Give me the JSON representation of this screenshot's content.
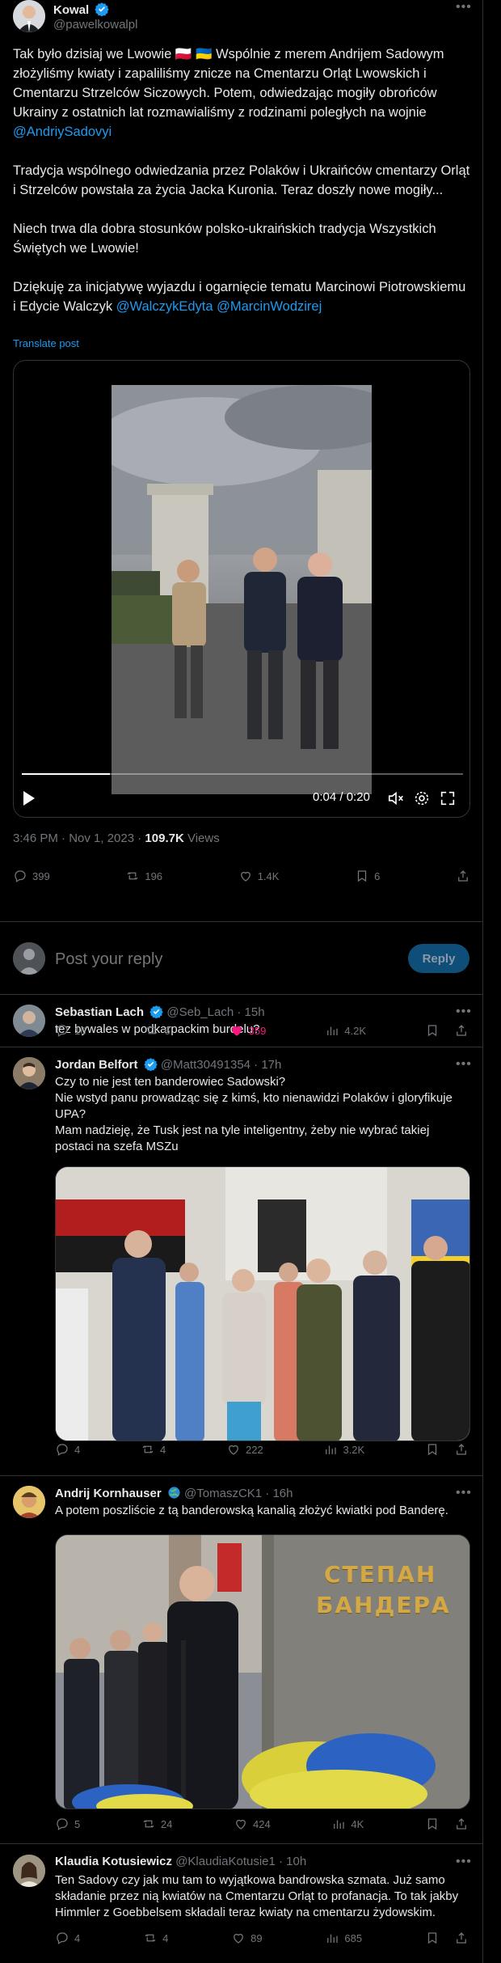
{
  "main_post": {
    "display_name": "Kowal",
    "handle": "@pawelkowalpl",
    "paragraphs": [
      "Tak było dzisiaj we Lwowie 🇵🇱 🇺🇦 Wspólnie z merem Andrijem Sadowym złożyliśmy kwiaty i zapaliliśmy znicze na Cmentarzu Orląt Lwowskich i Cmentarzu Strzelców Siczowych. Potem, odwiedzając mogiły obrońców Ukrainy z ostatnich lat rozmawialiśmy z rodzinami poległych na wojnie",
      "Tradycja wspólnego odwiedzania przez Polaków i Ukraińców cmentarzy Orląt i Strzelców powstała za życia Jacka Kuronia. Teraz doszły nowe mogiły...",
      "Niech trwa dla dobra stosunków polsko-ukraińskich tradycja Wszystkich Świętych we Lwowie!",
      "Dziękuję za inicjatywę wyjazdu i ogarnięcie tematu Marcinowi Piotrowskiemu i Edycie Walczyk"
    ],
    "mention_1": "@AndriySadovyi",
    "mention_2": "@WalczykEdyta",
    "mention_3": "@MarcinWodzirej",
    "translate": "Translate post",
    "video_time": "0:04 / 0:20",
    "video_progress": 0.2,
    "timestamp": "3:46 PM · Nov 1, 2023 · ",
    "views_count": "109.7K",
    "views_label": " Views",
    "stats": {
      "replies": "399",
      "reposts": "196",
      "likes": "1.4K",
      "bookmarks": "6"
    }
  },
  "composer": {
    "placeholder": "Post your reply",
    "button": "Reply"
  },
  "replies": [
    {
      "name": "Sebastian Lach",
      "handle": "@Seb_Lach",
      "time": "· 15h",
      "text": "tez bywales w podkarpackim burdelu?",
      "stats": {
        "replies": "16",
        "reposts": "6",
        "likes": "359",
        "views": "4.2K"
      }
    },
    {
      "name": "Jordan Belfort",
      "handle": "@Matt30491354",
      "time": "· 17h",
      "lines": [
        "Czy to nie jest ten banderowiec Sadowski?",
        "Nie wstyd panu prowadząc się z kimś, kto nienawidzi Polaków i gloryfikuje UPA?",
        "Mam nadzieję, że Tusk jest na tyle inteligentny, żeby nie wybrać takiej postaci na szefa MSZu"
      ],
      "stats": {
        "replies": "4",
        "reposts": "4",
        "likes": "222",
        "views": "3.2K"
      }
    },
    {
      "name": "Andrij Kornhauser",
      "handle": "@TomaszCK1",
      "time": "· 16h",
      "text": "A potem poszliście z tą banderowską kanalią złożyć kwiatki pod Banderę.",
      "monument_line1": "СТЕПАН",
      "monument_line2": "БАНДЕРА",
      "stats": {
        "replies": "5",
        "reposts": "24",
        "likes": "424",
        "views": "4K"
      }
    },
    {
      "name": "Klaudia Kotusiewicz",
      "handle": "@KlaudiaKotusie1",
      "time": "· 10h",
      "text": "Ten Sadovy czy jak mu tam to wyjątkowa bandrowska szmata. Już samo składanie przez nią kwiatów na Cmentarzu Orląt to profanacja. To tak jakby Himmler z Goebbelsem składali teraz kwiaty na cmentarzu żydowskim.",
      "stats": {
        "replies": "4",
        "reposts": "4",
        "likes": "89",
        "views": "685"
      }
    }
  ],
  "colors": {
    "accent": "#1d9bf0",
    "like_active": "#f91880",
    "border": "#2f3336",
    "muted": "#71767b"
  }
}
